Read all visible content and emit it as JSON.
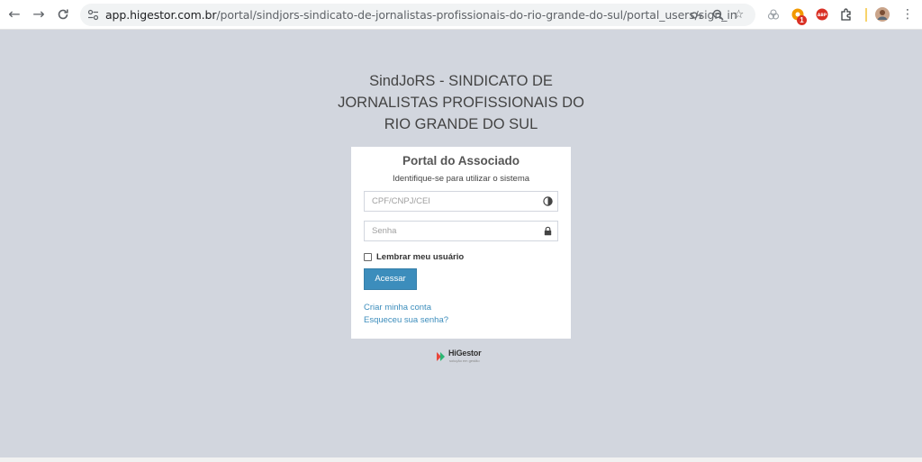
{
  "browser": {
    "url_host": "app.higestor.com.br",
    "url_path": "/portal/sindjors-sindicato-de-jornalistas-profissionais-do-rio-grande-do-sul/portal_users/sign_in",
    "extension_badge": "1",
    "ext_abp_label": "ABP"
  },
  "page": {
    "org_title_line1": "SindJoRS - SINDICATO DE",
    "org_title_line2": "JORNALISTAS PROFISSIONAIS DO",
    "org_title_line3": "RIO GRANDE DO SUL"
  },
  "login": {
    "title": "Portal do Associado",
    "subtitle": "Identifique-se para utilizar o sistema",
    "cpf_placeholder": "CPF/CNPJ/CEI",
    "password_placeholder": "Senha",
    "remember_label": "Lembrar meu usuário",
    "submit_label": "Acessar",
    "create_account_link": "Criar minha conta",
    "forgot_password_link": "Esqueceu sua senha?"
  },
  "footer": {
    "logo_text": "HiGestor",
    "logo_tagline": "solução em gestão"
  },
  "colors": {
    "page_bg": "#d2d6de",
    "primary": "#3c8dbc",
    "box_bg": "#ffffff"
  }
}
